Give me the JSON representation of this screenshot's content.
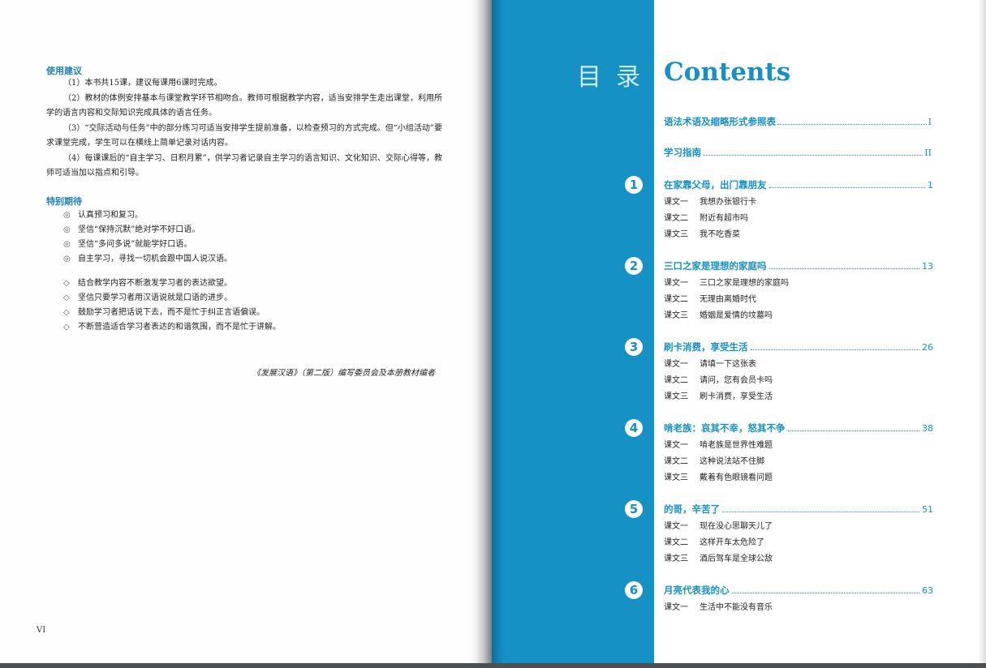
{
  "left": {
    "usage_heading": "使用建议",
    "usage_paragraphs": [
      "（1）本书共15课，建议每课用6课时完成。",
      "（2）教材的体例安排基本与课堂教学环节相吻合。教师可根据教学内容，适当安排学生走出课堂，利用所学的语言内容和交际知识完成具体的语言任务。",
      "（3）“交际活动与任务”中的部分练习可适当安排学生提前准备，以检查预习的方式完成。但“小组活动”要求课堂完成，学生可以在横线上简单记录对话内容。",
      "（4）每课课后的“自主学习、日积月累”，供学习者记录自主学习的语言知识、文化知识、交际心得等，教师可适当加以指点和引导。"
    ],
    "expect_heading": "特别期待",
    "student_items": [
      "认真预习和复习。",
      "坚信“保持沉默”绝对学不好口语。",
      "坚信“多问多说”就能学好口语。",
      "自主学习，寻找一切机会跟中国人说汉语。"
    ],
    "student_mark": "◎",
    "teacher_items": [
      "结合教学内容不断激发学习者的表达欲望。",
      "坚信只要学习者用汉语说就是口语的进步。",
      "鼓励学习者把话说下去，而不是忙于纠正言语偏误。",
      "不断营造适合学习者表达的和谐氛围，而不是忙于讲解。"
    ],
    "teacher_mark": "◇",
    "credit": "《发展汉语》（第二版）编写委员会及本册教材编者",
    "page_number": "VI"
  },
  "right": {
    "mulu": "目录",
    "contents_title": "Contents",
    "front_entries": [
      {
        "title": "语法术语及缩略形式参照表",
        "page": "I"
      },
      {
        "title": "学习指南",
        "page": "II"
      }
    ],
    "units": [
      {
        "num": "1",
        "title": "在家靠父母，出门靠朋友",
        "page": "1",
        "lessons": [
          {
            "label": "课文一",
            "title": "我想办张银行卡"
          },
          {
            "label": "课文二",
            "title": "附近有超市吗"
          },
          {
            "label": "课文三",
            "title": "我不吃香菜"
          }
        ]
      },
      {
        "num": "2",
        "title": "三口之家是理想的家庭吗",
        "page": "13",
        "lessons": [
          {
            "label": "课文一",
            "title": "三口之家是理想的家庭吗"
          },
          {
            "label": "课文二",
            "title": "无理由离婚时代"
          },
          {
            "label": "课文三",
            "title": "婚姻是爱情的坟墓吗"
          }
        ]
      },
      {
        "num": "3",
        "title": "刷卡消费，享受生活",
        "page": "26",
        "lessons": [
          {
            "label": "课文一",
            "title": "请填一下这张表"
          },
          {
            "label": "课文二",
            "title": "请问，您有会员卡吗"
          },
          {
            "label": "课文三",
            "title": "刷卡消费，享受生活"
          }
        ]
      },
      {
        "num": "4",
        "title": "啃老族：哀其不幸，怒其不争",
        "page": "38",
        "lessons": [
          {
            "label": "课文一",
            "title": "啃老族是世界性难题"
          },
          {
            "label": "课文二",
            "title": "这种说法站不住脚"
          },
          {
            "label": "课文三",
            "title": "戴着有色眼镜看问题"
          }
        ]
      },
      {
        "num": "5",
        "title": "的哥，辛苦了",
        "page": "51",
        "lessons": [
          {
            "label": "课文一",
            "title": "现在没心思聊天儿了"
          },
          {
            "label": "课文二",
            "title": "这样开车太危险了"
          },
          {
            "label": "课文三",
            "title": "酒后驾车是全球公敌"
          }
        ]
      },
      {
        "num": "6",
        "title": "月亮代表我的心",
        "page": "63",
        "lessons": [
          {
            "label": "课文一",
            "title": "生活中不能没有音乐"
          }
        ]
      }
    ]
  },
  "colors": {
    "accent": "#1591c5",
    "heading_left": "#1f7fb3"
  }
}
